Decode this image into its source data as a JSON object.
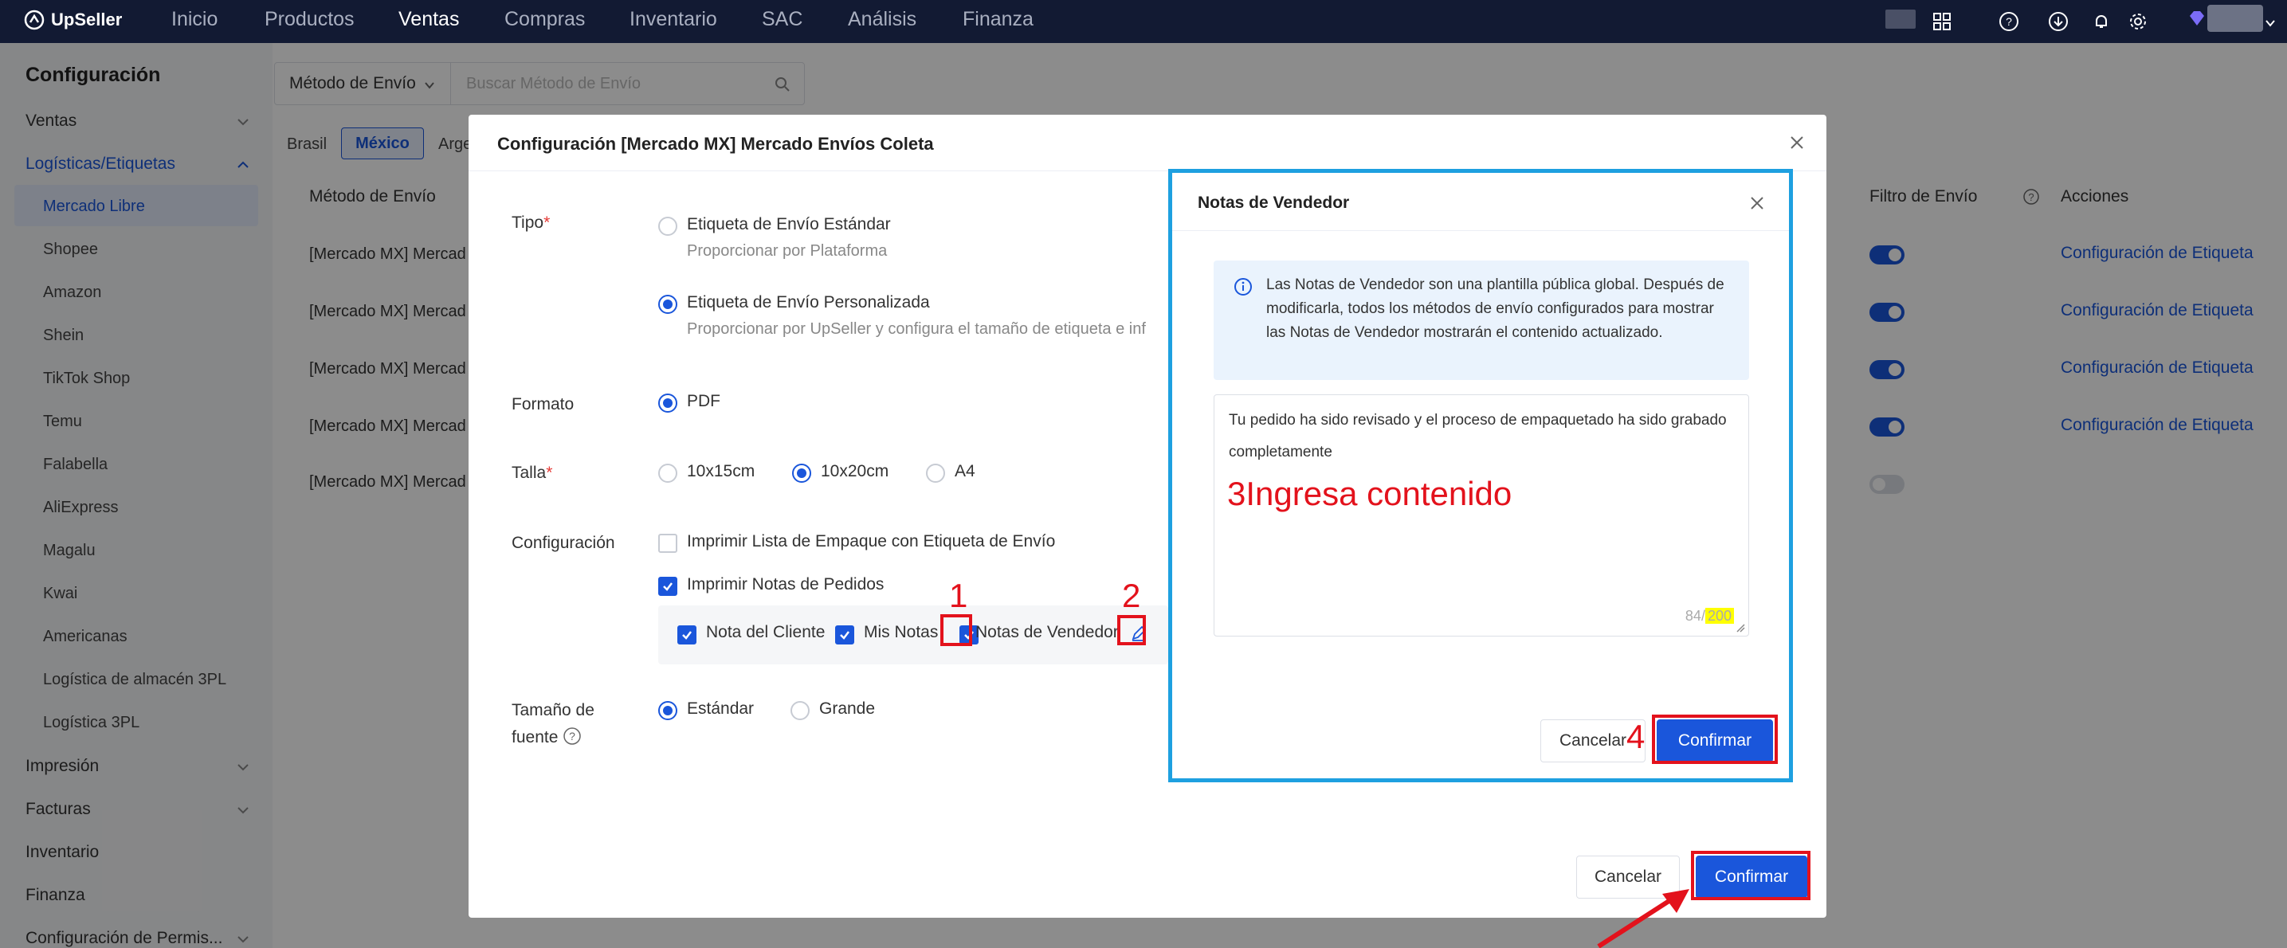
{
  "app": {
    "logo": "UpSeller"
  },
  "topnav": {
    "items": [
      "Inicio",
      "Productos",
      "Ventas",
      "Compras",
      "Inventario",
      "SAC",
      "Análisis",
      "Finanza"
    ],
    "active": "Ventas"
  },
  "sidebar": {
    "title": "Configuración",
    "groups": {
      "ventas": "Ventas",
      "logisticas": "Logísticas/Etiquetas",
      "impresion": "Impresión",
      "facturas": "Facturas",
      "inventario": "Inventario",
      "finanza": "Finanza",
      "permisos": "Configuración de Permis..."
    },
    "items": [
      "Mercado Libre",
      "Shopee",
      "Amazon",
      "Shein",
      "TikTok Shop",
      "Temu",
      "Falabella",
      "AliExpress",
      "Magalu",
      "Kwai",
      "Americanas",
      "Logística de almacén 3PL",
      "Logística 3PL"
    ],
    "selected": "Mercado Libre"
  },
  "main": {
    "filter": {
      "select": "Método de Envío",
      "placeholder": "Buscar Método de Envío"
    },
    "countries": [
      "Brasil",
      "México",
      "Arge"
    ],
    "table": {
      "headers": {
        "method": "Método de Envío",
        "filter": "Filtro de Envío",
        "actions": "Acciones"
      },
      "rows": [
        {
          "method": "[Mercado MX] Mercad",
          "filter_on": true,
          "action": "Configuración de Etiqueta"
        },
        {
          "method": "[Mercado MX] Mercad",
          "filter_on": true,
          "action": "Configuración de Etiqueta"
        },
        {
          "method": "[Mercado MX] Mercad",
          "filter_on": true,
          "action": "Configuración de Etiqueta"
        },
        {
          "method": "[Mercado MX] Mercad",
          "filter_on": true,
          "action": "Configuración de Etiqueta"
        },
        {
          "method": "[Mercado MX] Mercad",
          "filter_on": false,
          "action": ""
        }
      ]
    }
  },
  "modal": {
    "title": "Configuración [Mercado MX] Mercado Envíos Coleta",
    "tipo": {
      "label": "Tipo",
      "option1": "Etiqueta de Envío Estándar",
      "option1_sub": "Proporcionar por Plataforma",
      "option2": "Etiqueta de Envío Personalizada",
      "option2_sub": "Proporcionar por UpSeller y configura el tamaño de etiqueta e inf"
    },
    "formato": {
      "label": "Formato",
      "option": "PDF"
    },
    "talla": {
      "label": "Talla",
      "options": [
        "10x15cm",
        "10x20cm",
        "A4"
      ],
      "selected": "10x20cm"
    },
    "configuracion": {
      "label": "Configuración",
      "opt1": "Imprimir Lista de Empaque con Etiqueta de Envío",
      "opt2": "Imprimir Notas de Pedidos",
      "notes": {
        "cliente": "Nota del Cliente",
        "mis": "Mis Notas",
        "vendedor": "Notas de Vendedor"
      }
    },
    "fuente": {
      "label_line1": "Tamaño de",
      "label_line2": "fuente",
      "options": [
        "Estándar",
        "Grande"
      ],
      "selected": "Estándar"
    },
    "cancel": "Cancelar",
    "confirm": "Confirmar"
  },
  "notes_modal": {
    "title": "Notas de Vendedor",
    "info": "Las Notas de Vendedor son una plantilla pública global. Después de modificarla, todos los métodos de envío configurados para mostrar las Notas de Vendedor mostrarán el contenido actualizado.",
    "content": "Tu pedido ha sido revisado y el proceso de empaquetado ha sido grabado completamente",
    "count_current": "84/",
    "count_max": "200",
    "cancel": "Cancelar",
    "confirm": "Confirmar"
  },
  "annotations": {
    "n1": "1",
    "n2": "2",
    "n3": "3",
    "n3_text": "Ingresa contenido",
    "n4": "4"
  },
  "colors": {
    "primary": "#1a56db",
    "annotation": "#e3121c",
    "highlight_border": "#1ea0e0",
    "nav_bg": "#121a33"
  }
}
